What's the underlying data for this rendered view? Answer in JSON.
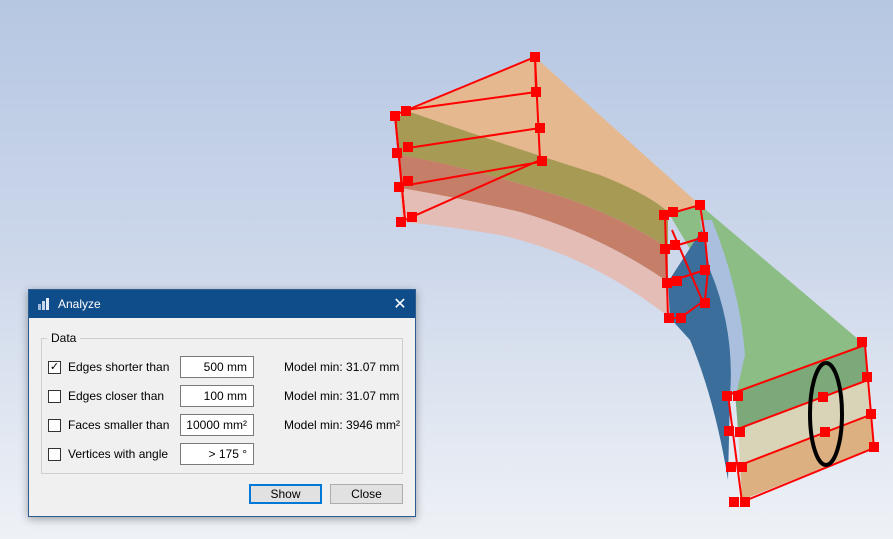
{
  "dialog": {
    "title": "Analyze",
    "close_glyph": "✕",
    "group_label": "Data",
    "rows": [
      {
        "checked": true,
        "check_glyph": "✓",
        "label": "Edges shorter than",
        "value": "500 mm",
        "model": "Model min: 31.07 mm"
      },
      {
        "checked": false,
        "check_glyph": "",
        "label": "Edges closer than",
        "value": "100 mm",
        "model": "Model min: 31.07 mm"
      },
      {
        "checked": false,
        "check_glyph": "",
        "label": "Faces smaller than",
        "value": "10000 mm²",
        "model": "Model min: 3946 mm²"
      },
      {
        "checked": false,
        "check_glyph": "",
        "label": "Vertices with angle",
        "value": "> 175 °",
        "model": ""
      }
    ],
    "show_label": "Show",
    "close_label": "Close"
  },
  "colors": {
    "titlebar": "#0f4c8a",
    "marker": "#ff0000",
    "highlight_ellipse": "#000000"
  },
  "icons": {
    "app": "analyze-app-icon",
    "close": "close-icon"
  }
}
